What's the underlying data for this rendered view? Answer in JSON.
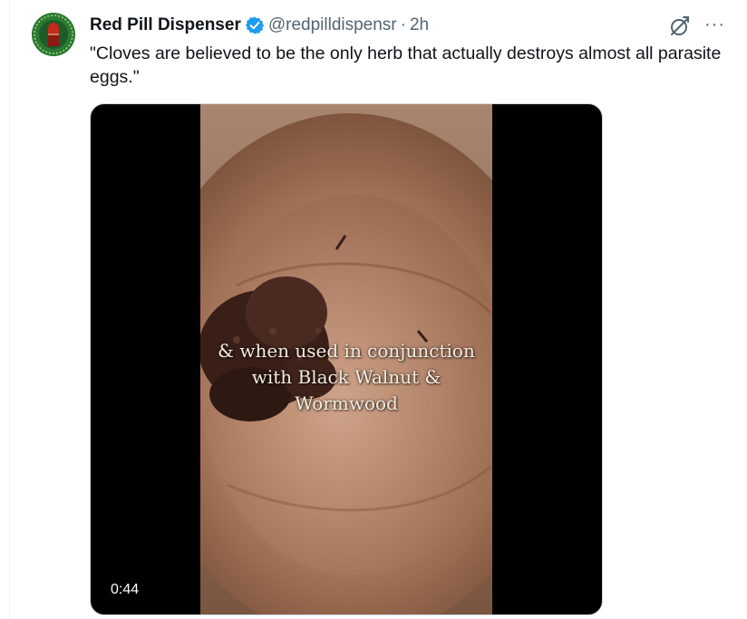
{
  "post": {
    "author_name": "Red Pill Dispenser",
    "handle": "@redpilldispensr",
    "separator": "·",
    "time": "2h",
    "text": "\"Cloves are believed to be the only herb that actually destroys almost all parasite eggs.\"",
    "more_label": "···"
  },
  "video": {
    "caption_lines": [
      "& when used in conjunction",
      "with Black Walnut &",
      "Wormwood"
    ],
    "duration": "0:44"
  },
  "colors": {
    "text_primary": "#0f1419",
    "text_secondary": "#536471",
    "verified_blue": "#1d9bf0",
    "border": "#cfd9de"
  },
  "icons": {
    "verified": "verified-badge-icon",
    "grok": "grok-icon",
    "more": "more-options-icon"
  }
}
